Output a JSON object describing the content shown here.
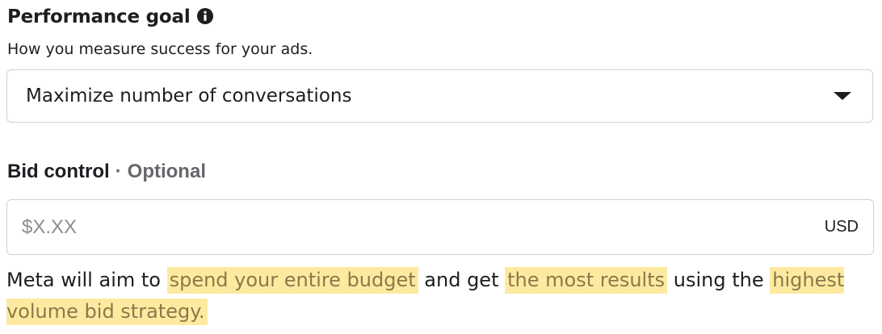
{
  "performance_goal": {
    "title": "Performance goal",
    "info_icon": "info-circle-icon",
    "subtitle": "How you measure success for your ads.",
    "selected_value": "Maximize number of conversations",
    "dropdown_icon": "caret-down-icon"
  },
  "bid_control": {
    "title": "Bid control",
    "separator": "·",
    "optional_label": "Optional",
    "input_value": "",
    "input_placeholder": "$X.XX",
    "currency": "USD",
    "description": {
      "part1": "Meta will aim to ",
      "highlight1": "spend your entire budget",
      "part2": " and get ",
      "highlight2": "the most results",
      "part3": " using the ",
      "highlight3": "highest volume bid strategy."
    }
  },
  "colors": {
    "text": "#1c1e21",
    "muted": "#65676b",
    "border": "#ccd0d5",
    "highlight_bg": "#fdeaa0",
    "highlight_text": "#8a7a4a"
  }
}
